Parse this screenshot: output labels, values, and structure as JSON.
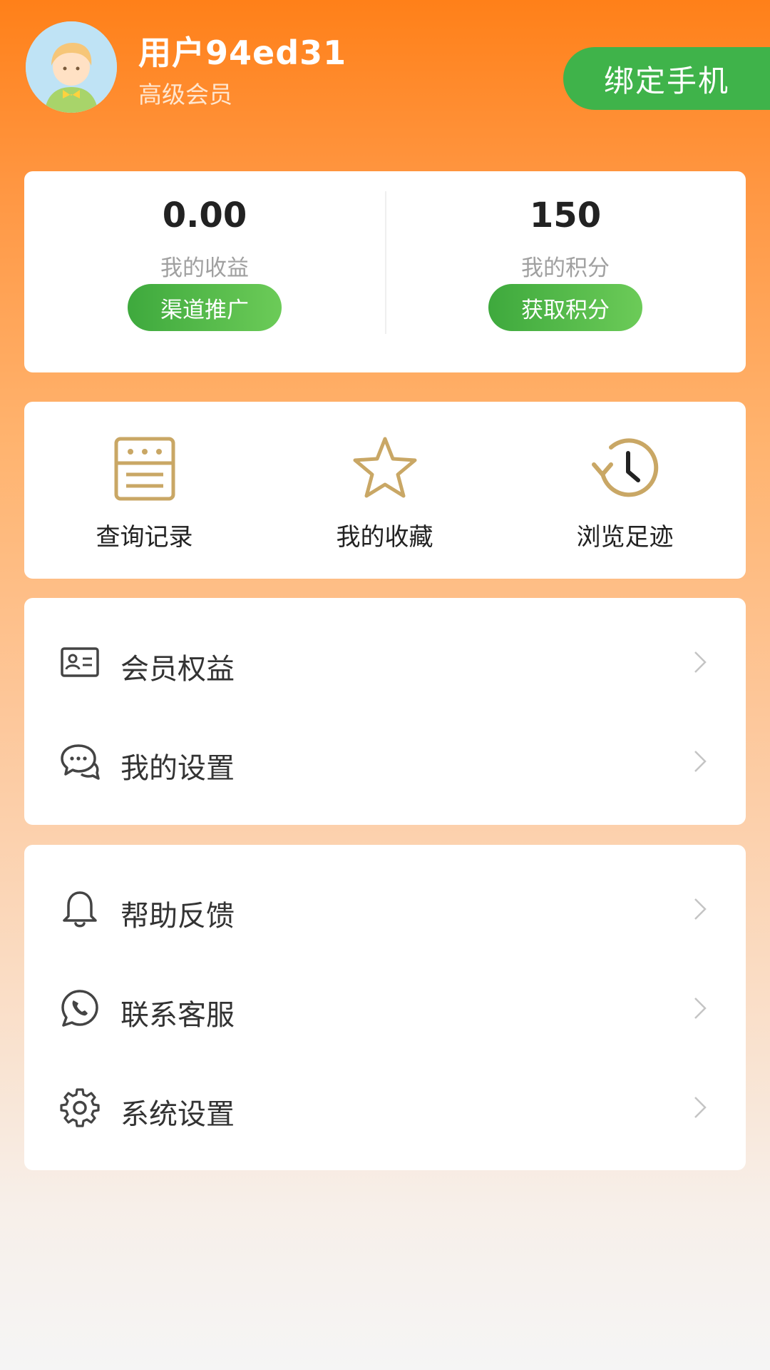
{
  "user": {
    "name": "用户94ed31",
    "level": "高级会员",
    "avatar_icon": "avatar-icon",
    "bind_phone_label": "绑定手机"
  },
  "stats": {
    "earnings": {
      "value": "0.00",
      "label": "我的收益",
      "button": "渠道推广"
    },
    "points": {
      "value": "150",
      "label": "我的积分",
      "button": "获取积分"
    }
  },
  "shortcuts": [
    {
      "label": "查询记录",
      "icon": "document-icon"
    },
    {
      "label": "我的收藏",
      "icon": "star-icon"
    },
    {
      "label": "浏览足迹",
      "icon": "history-icon"
    }
  ],
  "menu_group_1": [
    {
      "label": "会员权益",
      "icon": "member-card-icon"
    },
    {
      "label": "我的设置",
      "icon": "chat-bubbles-icon"
    }
  ],
  "menu_group_2": [
    {
      "label": "帮助反馈",
      "icon": "bell-icon"
    },
    {
      "label": "联系客服",
      "icon": "phone-chat-icon"
    },
    {
      "label": "系统设置",
      "icon": "gear-icon"
    }
  ],
  "colors": {
    "accent_orange": "#FF8019",
    "green": "#3FB34A",
    "icon_gold": "#C9A765"
  }
}
